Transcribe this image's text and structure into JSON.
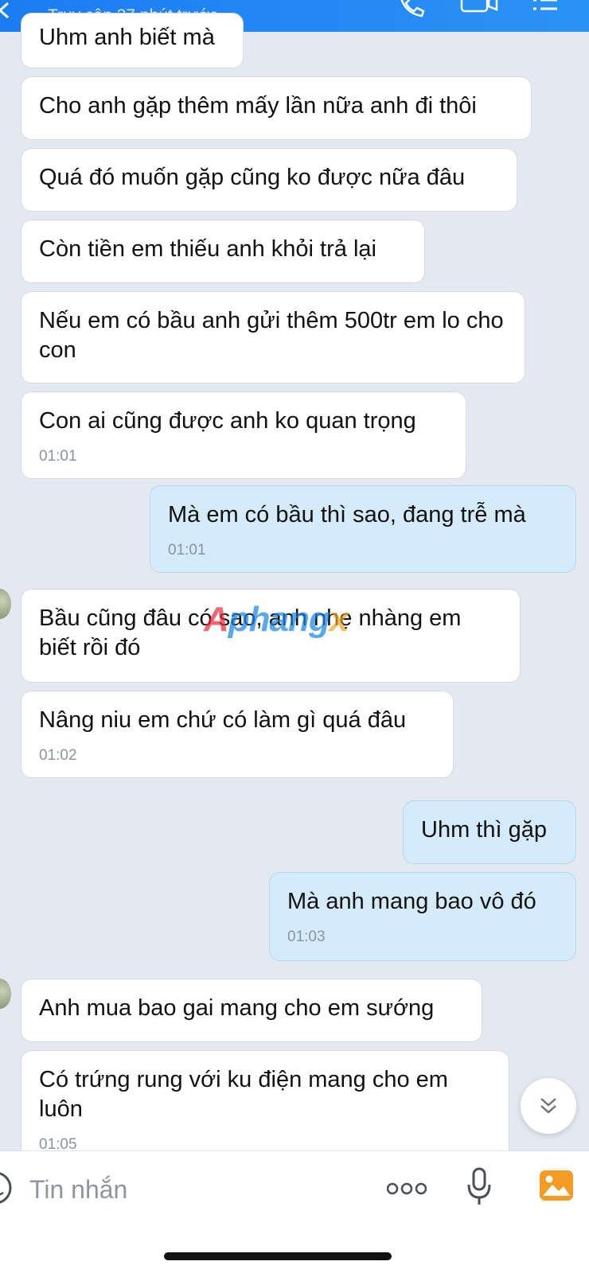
{
  "header": {
    "status": "Truy cập 37 phút trước",
    "icons": [
      "back-icon",
      "phone-icon",
      "video-icon",
      "menu-icon"
    ]
  },
  "messages": [
    {
      "text": "Uhm anh biết mà",
      "time": ""
    },
    {
      "text": "Cho anh gặp thêm mấy lần nữa anh đi thôi",
      "time": ""
    },
    {
      "text": "Quá đó muốn gặp cũng ko được nữa đâu",
      "time": ""
    },
    {
      "text": "Còn tiền em thiếu anh khỏi trả lại",
      "time": ""
    },
    {
      "text": "Nếu em có bầu anh gửi thêm 500tr em lo cho con",
      "time": ""
    },
    {
      "text": "Con ai cũng được anh ko quan trọng",
      "time": "01:01"
    },
    {
      "text": "Mà em có bầu thì sao, đang trễ mà",
      "time": "01:01"
    },
    {
      "text": "Bầu cũng đâu có sao, anh nhẹ nhàng em biết rồi đó",
      "time": ""
    },
    {
      "text": "Nâng niu em chứ có làm gì quá đâu",
      "time": "01:02"
    },
    {
      "text": "Uhm thì gặp",
      "time": ""
    },
    {
      "text": "Mà anh mang bao vô đó",
      "time": "01:03"
    },
    {
      "text": "Anh mua bao gai mang cho em sướng",
      "time": ""
    },
    {
      "text": "Có trứng rung với ku điện mang cho em luôn",
      "time": "01:05"
    }
  ],
  "watermark": {
    "part1": "A",
    "part2": "phang",
    "part3": "x"
  },
  "composer": {
    "placeholder": "Tin nhắn",
    "icons": [
      "sticker-icon",
      "more-icon",
      "mic-icon",
      "image-icon"
    ]
  },
  "colors": {
    "header": "#1c7cf2",
    "background": "#e2e9f1",
    "incoming_bubble": "#ffffff",
    "outgoing_bubble": "#d4ebfc",
    "image_icon": "#f59a23"
  }
}
